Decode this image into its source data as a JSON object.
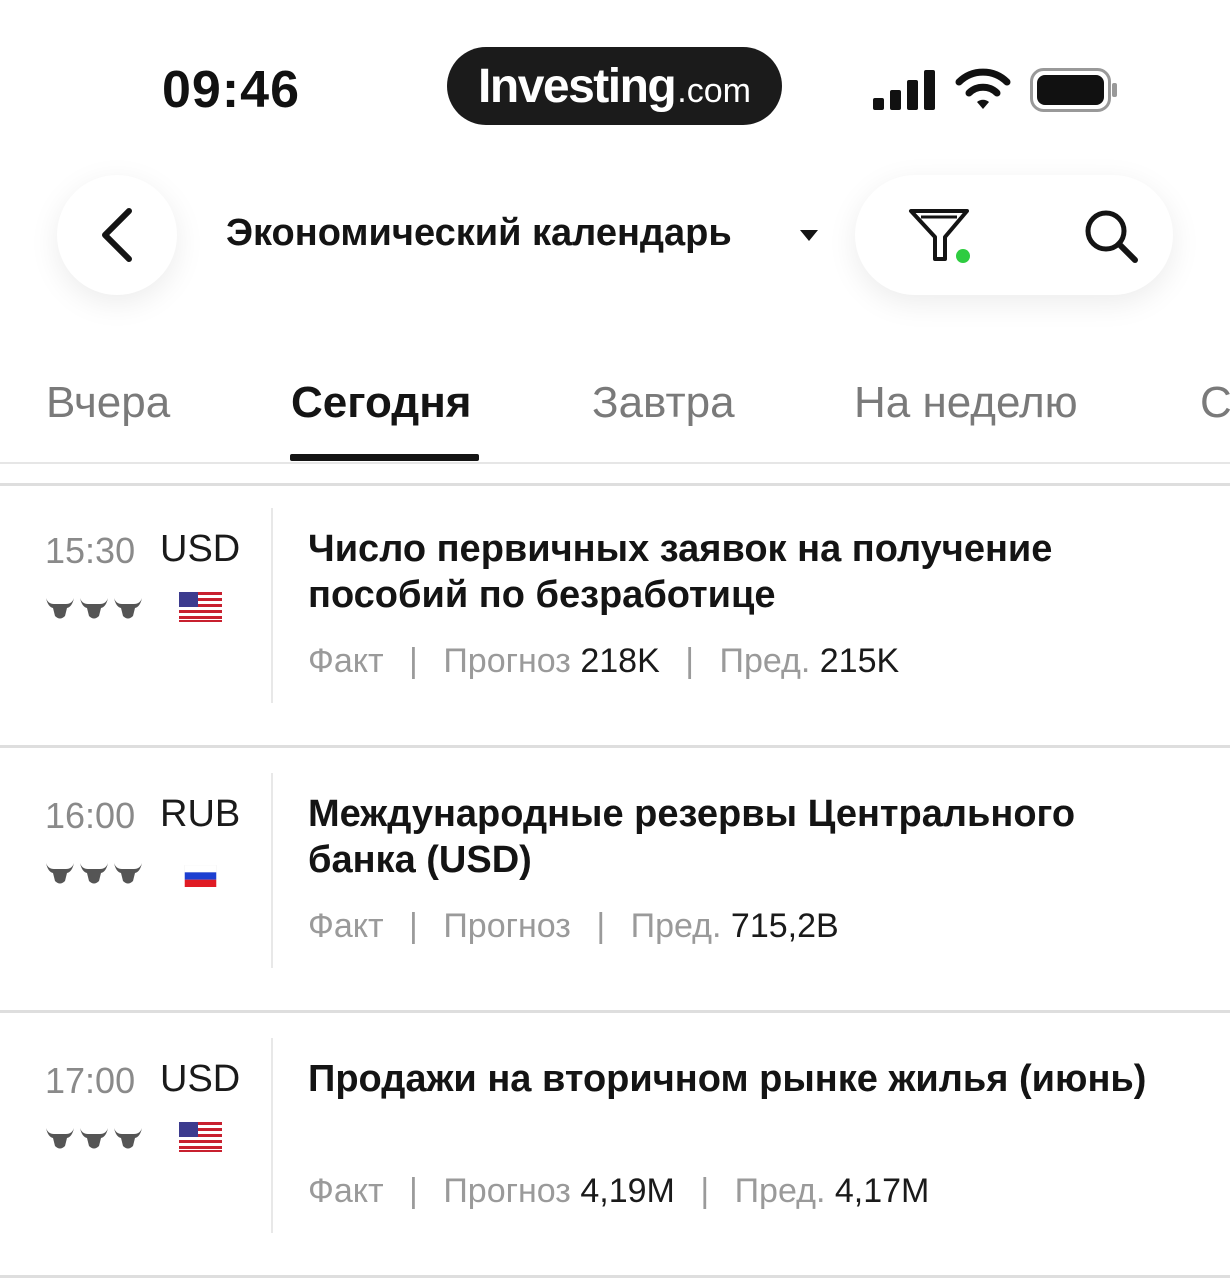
{
  "status_bar": {
    "time": "09:46"
  },
  "brand": {
    "name": "Investing",
    "suffix": ".com"
  },
  "header": {
    "title": "Экономический календарь"
  },
  "tabs": [
    {
      "label": "Вчера",
      "active": false
    },
    {
      "label": "Сегодня",
      "active": true
    },
    {
      "label": "Завтра",
      "active": false
    },
    {
      "label": "На неделю",
      "active": false
    },
    {
      "label": "С",
      "active": false
    }
  ],
  "meta_labels": {
    "actual": "Факт",
    "forecast": "Прогноз",
    "previous": "Пред.",
    "divider": "|"
  },
  "events": [
    {
      "time": "15:30",
      "currency": "USD",
      "country": "us",
      "title": "Число первичных заявок на получение пособий по безработице",
      "actual": "",
      "forecast": "218K",
      "previous": "215K"
    },
    {
      "time": "16:00",
      "currency": "RUB",
      "country": "ru",
      "title": "Международные резервы Центрального банка (USD)",
      "actual": "",
      "forecast": "",
      "previous": "715,2B"
    },
    {
      "time": "17:00",
      "currency": "USD",
      "country": "us",
      "title": "Продажи на вторичном рынке жилья (июнь)",
      "actual": "",
      "forecast": "4,19M",
      "previous": "4,17M"
    }
  ],
  "icons": {
    "back": "chevron-left-icon",
    "caret": "caret-down-icon",
    "filter": "filter-icon",
    "search": "search-icon",
    "importance": "bull-icon"
  },
  "colors": {
    "filter_dot": "#2ecc40",
    "text_dark": "#141414",
    "muted": "#8a8a8a"
  }
}
